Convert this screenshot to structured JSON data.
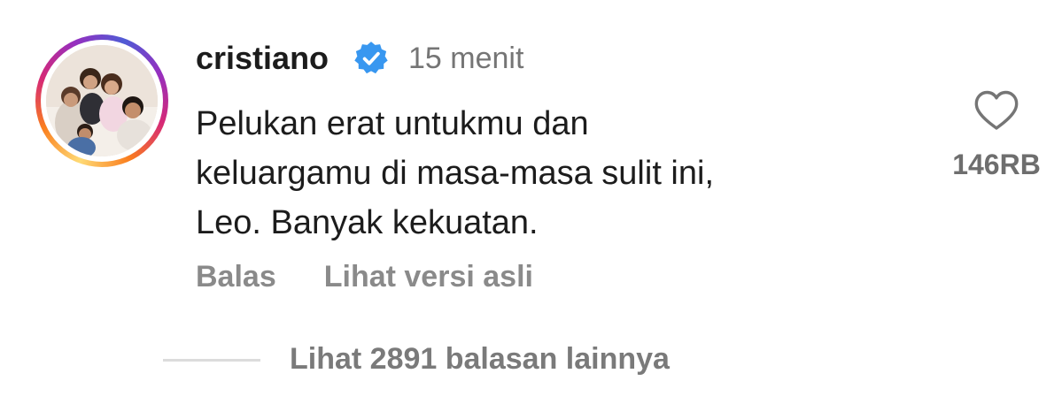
{
  "comment": {
    "username": "cristiano",
    "verified": true,
    "timestamp": "15 menit",
    "text_lines": [
      "Pelukan erat untukmu dan",
      "keluargamu di masa-masa sulit ini,",
      "Leo. Banyak kekuatan."
    ],
    "actions": {
      "reply_label": "Balas",
      "see_original_label": "Lihat versi asli"
    },
    "likes": {
      "icon": "heart-outline-icon",
      "count": "146RB"
    },
    "replies": {
      "label": "Lihat 2891 balasan lainnya"
    }
  },
  "colors": {
    "verified_badge": "#3897f0",
    "text_primary": "#1c1c1c",
    "text_secondary": "#757575"
  }
}
